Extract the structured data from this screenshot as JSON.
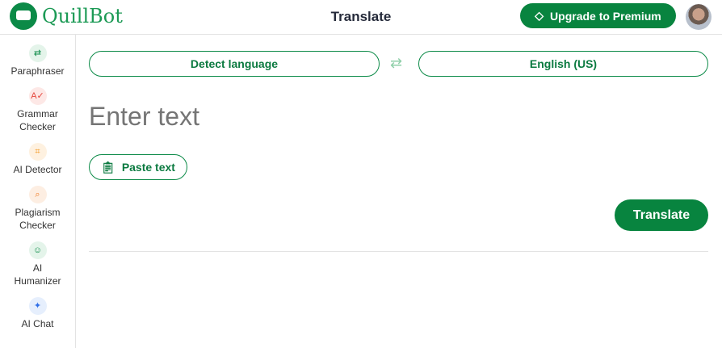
{
  "header": {
    "logo": "QuillBot",
    "title": "Translate",
    "upgrade_label": "Upgrade to Premium"
  },
  "sidebar": {
    "items": [
      {
        "label": "Paraphraser",
        "icon": "paraphraser-icon",
        "color": "#0b8a47",
        "bg": "#e4f4ea",
        "glyph": "⇄"
      },
      {
        "label": "Grammar Checker",
        "icon": "grammar-icon",
        "color": "#e5443a",
        "bg": "#fde8e6",
        "glyph": "A✓"
      },
      {
        "label": "AI Detector",
        "icon": "ai-detector-icon",
        "color": "#f29111",
        "bg": "#fef1e0",
        "glyph": "⌗"
      },
      {
        "label": "Plagiarism Checker",
        "icon": "plagiarism-icon",
        "color": "#f07b22",
        "bg": "#fdeee2",
        "glyph": "⌕"
      },
      {
        "label": "AI Humanizer",
        "icon": "humanizer-icon",
        "color": "#0b8a47",
        "bg": "#e4f4ea",
        "glyph": "☺"
      },
      {
        "label": "AI Chat",
        "icon": "ai-chat-icon",
        "color": "#2f6fe8",
        "bg": "#e6effd",
        "glyph": "✦"
      }
    ]
  },
  "main": {
    "source_language": "Detect language",
    "target_language": "English (US)",
    "placeholder": "Enter text",
    "paste_label": "Paste text",
    "translate_label": "Translate"
  }
}
